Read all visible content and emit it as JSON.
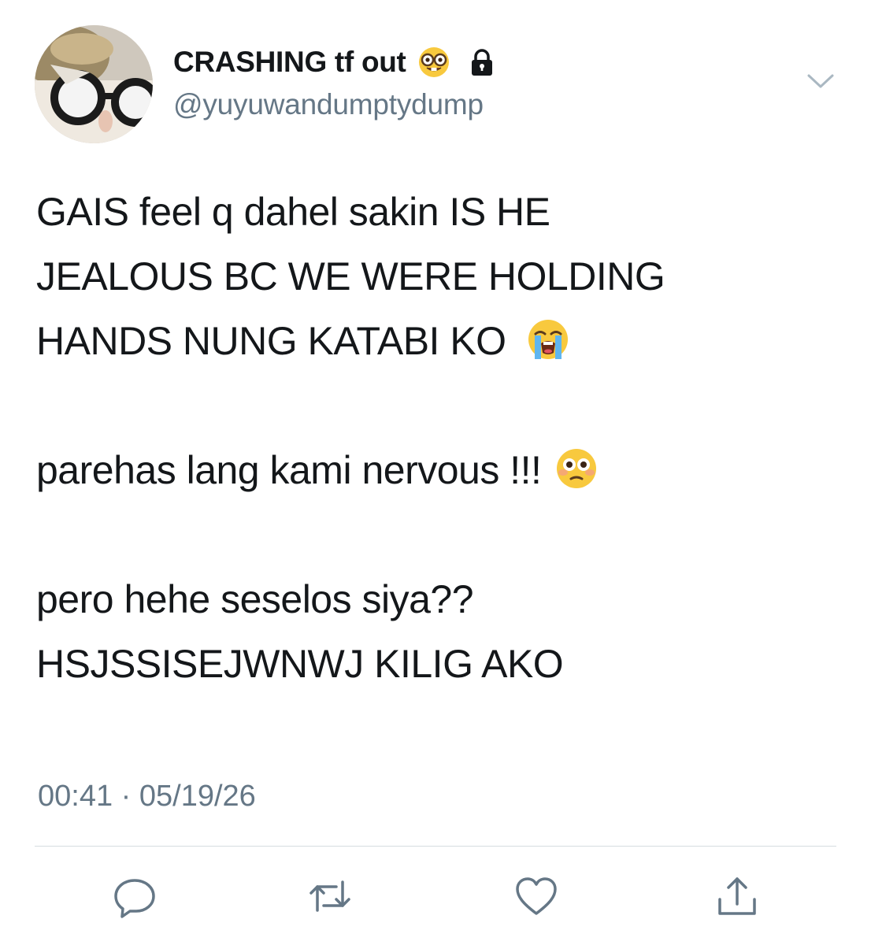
{
  "tweet": {
    "author": {
      "display_name": "CRASHING tf out",
      "handle": "@yuyuwandumptydump",
      "name_emoji": "nerd-face-emoji",
      "protected_icon": "lock-icon"
    },
    "menu_icon": "chevron-down-icon",
    "body": {
      "line1": "GAIS feel q dahel sakin IS HE",
      "line2": "JEALOUS BC WE WERE HOLDING",
      "line3": "HANDS NUNG KATABI KO",
      "line3_emoji": "loudly-crying-face-emoji",
      "line4": "parehas lang kami nervous !!!",
      "line4_emoji": "flushed-face-emoji",
      "line5": "pero hehe seselos siya??",
      "line6": "HSJSSISEJWNWJ KILIG AKO"
    },
    "timestamp": "00:41 · 05/19/26",
    "actions": {
      "reply": "reply-icon",
      "retweet": "retweet-icon",
      "like": "heart-icon",
      "share": "share-icon"
    }
  },
  "colors": {
    "text_primary": "#14171a",
    "text_secondary": "#657786",
    "icon_gray": "#657786",
    "divider": "#d6dce0"
  }
}
